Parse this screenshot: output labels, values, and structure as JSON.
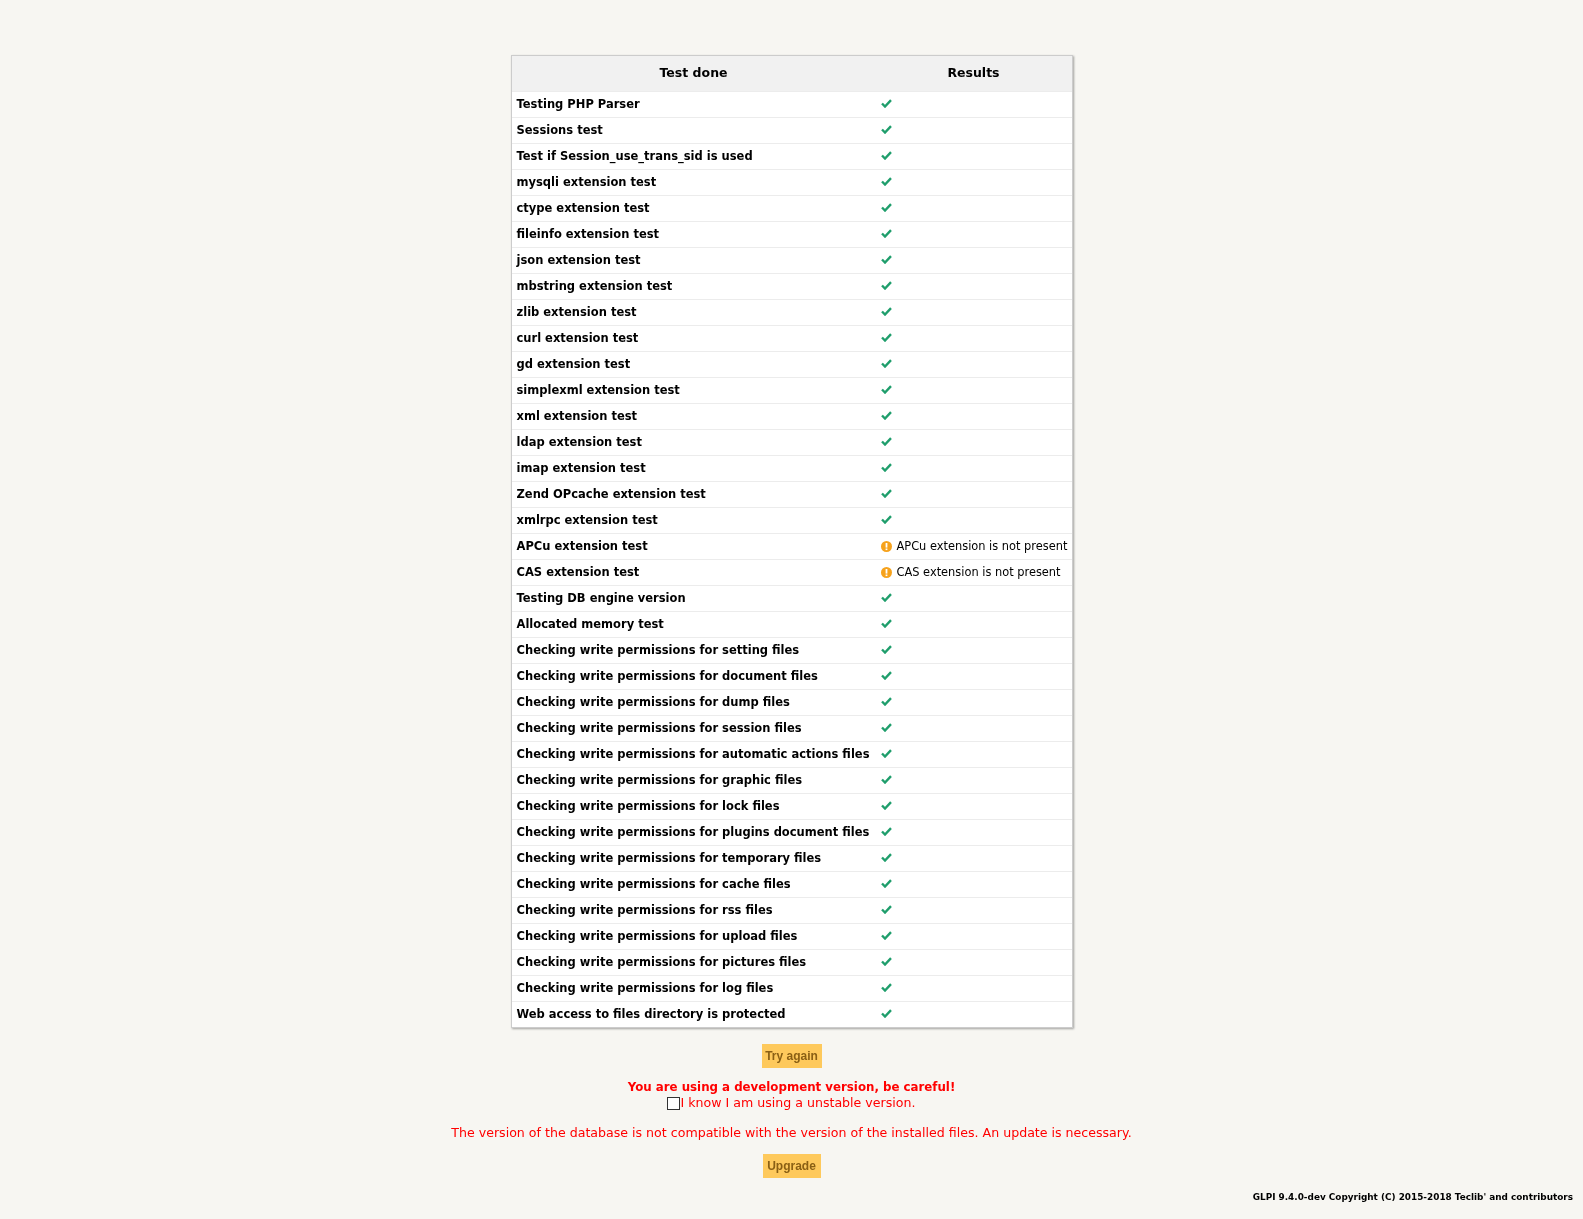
{
  "table": {
    "columns": [
      "Test done",
      "Results"
    ],
    "rows": [
      {
        "test": "Testing PHP Parser",
        "kind": "ok"
      },
      {
        "test": "Sessions test",
        "kind": "ok"
      },
      {
        "test": "Test if Session_use_trans_sid is used",
        "kind": "ok"
      },
      {
        "test": "mysqli extension test",
        "kind": "ok"
      },
      {
        "test": "ctype extension test",
        "kind": "ok"
      },
      {
        "test": "fileinfo extension test",
        "kind": "ok"
      },
      {
        "test": "json extension test",
        "kind": "ok"
      },
      {
        "test": "mbstring extension test",
        "kind": "ok"
      },
      {
        "test": "zlib extension test",
        "kind": "ok"
      },
      {
        "test": "curl extension test",
        "kind": "ok"
      },
      {
        "test": "gd extension test",
        "kind": "ok"
      },
      {
        "test": "simplexml extension test",
        "kind": "ok"
      },
      {
        "test": "xml extension test",
        "kind": "ok"
      },
      {
        "test": "ldap extension test",
        "kind": "ok"
      },
      {
        "test": "imap extension test",
        "kind": "ok"
      },
      {
        "test": "Zend OPcache extension test",
        "kind": "ok"
      },
      {
        "test": "xmlrpc extension test",
        "kind": "ok"
      },
      {
        "test": "APCu extension test",
        "kind": "warning",
        "message": "APCu extension is not present"
      },
      {
        "test": "CAS extension test",
        "kind": "warning",
        "message": "CAS extension is not present"
      },
      {
        "test": "Testing DB engine version",
        "kind": "ok"
      },
      {
        "test": "Allocated memory test",
        "kind": "ok"
      },
      {
        "test": "Checking write permissions for setting files",
        "kind": "ok"
      },
      {
        "test": "Checking write permissions for document files",
        "kind": "ok"
      },
      {
        "test": "Checking write permissions for dump files",
        "kind": "ok"
      },
      {
        "test": "Checking write permissions for session files",
        "kind": "ok"
      },
      {
        "test": "Checking write permissions for automatic actions files",
        "kind": "ok"
      },
      {
        "test": "Checking write permissions for graphic files",
        "kind": "ok"
      },
      {
        "test": "Checking write permissions for lock files",
        "kind": "ok"
      },
      {
        "test": "Checking write permissions for plugins document files",
        "kind": "ok"
      },
      {
        "test": "Checking write permissions for temporary files",
        "kind": "ok"
      },
      {
        "test": "Checking write permissions for cache files",
        "kind": "ok"
      },
      {
        "test": "Checking write permissions for rss files",
        "kind": "ok"
      },
      {
        "test": "Checking write permissions for upload files",
        "kind": "ok"
      },
      {
        "test": "Checking write permissions for pictures files",
        "kind": "ok"
      },
      {
        "test": "Checking write permissions for log files",
        "kind": "ok"
      },
      {
        "test": "Web access to files directory is protected",
        "kind": "ok"
      }
    ]
  },
  "try_again_button": "Try again",
  "dev_warning": "You are using a development version, be careful!",
  "unstable_checkbox": {
    "label": "I know I am using a unstable version.",
    "checked": false
  },
  "db_notice": "The version of the database is not compatible with the version of the installed files. An update is necessary.",
  "upgrade_button": "Upgrade",
  "footer": "GLPI 9.4.0-dev Copyright (C) 2015-2018 Teclib' and contributors"
}
